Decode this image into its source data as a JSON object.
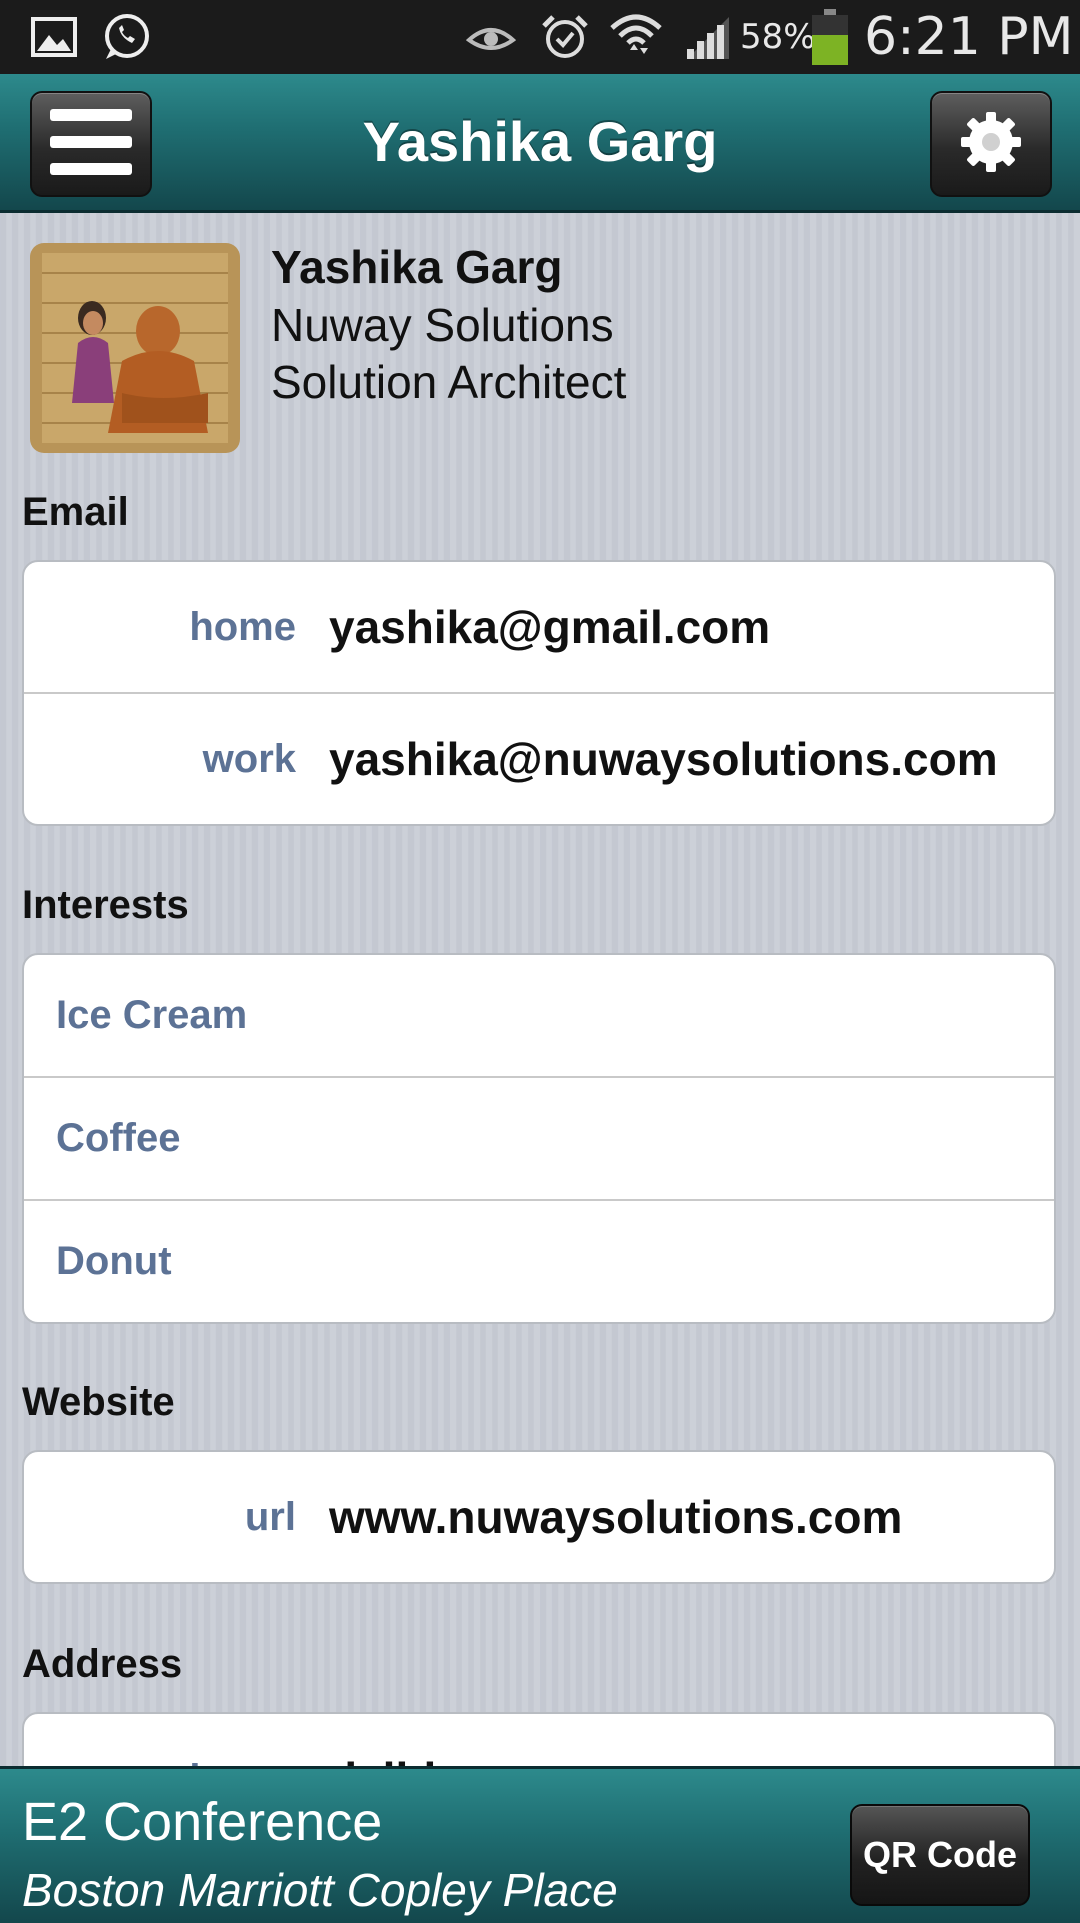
{
  "status_bar": {
    "battery_percent": "58%",
    "time": "6:21 PM",
    "icons": [
      "gallery-icon",
      "whatsapp-icon",
      "eye-icon",
      "alarm-icon",
      "wifi-icon",
      "signal-icon",
      "battery-icon"
    ]
  },
  "header": {
    "title": "Yashika Garg",
    "menu_icon": "hamburger-menu-icon",
    "settings_icon": "gear-icon"
  },
  "profile": {
    "name": "Yashika Garg",
    "company": "Nuway Solutions",
    "position": "Solution Architect"
  },
  "email": {
    "section_label": "Email",
    "rows": [
      {
        "label": "home",
        "value": "yashika@gmail.com"
      },
      {
        "label": "work",
        "value": "yashika@nuwaysolutions.com"
      }
    ]
  },
  "interests": {
    "section_label": "Interests",
    "items": [
      "Ice Cream",
      "Coffee",
      "Donut"
    ]
  },
  "website": {
    "section_label": "Website",
    "rows": [
      {
        "label": "url",
        "value": "www.nuwaysolutions.com"
      }
    ]
  },
  "address": {
    "section_label": "Address",
    "rows": [
      {
        "label": "home",
        "value": "delhi"
      }
    ]
  },
  "footer": {
    "event_title": "E2 Conference",
    "event_location": "Boston Marriott Copley Place",
    "qr_button_label": "QR Code"
  },
  "colors": {
    "header_teal": "#1f6e72",
    "label_blue": "#5c7295",
    "battery_green": "#7db324"
  }
}
